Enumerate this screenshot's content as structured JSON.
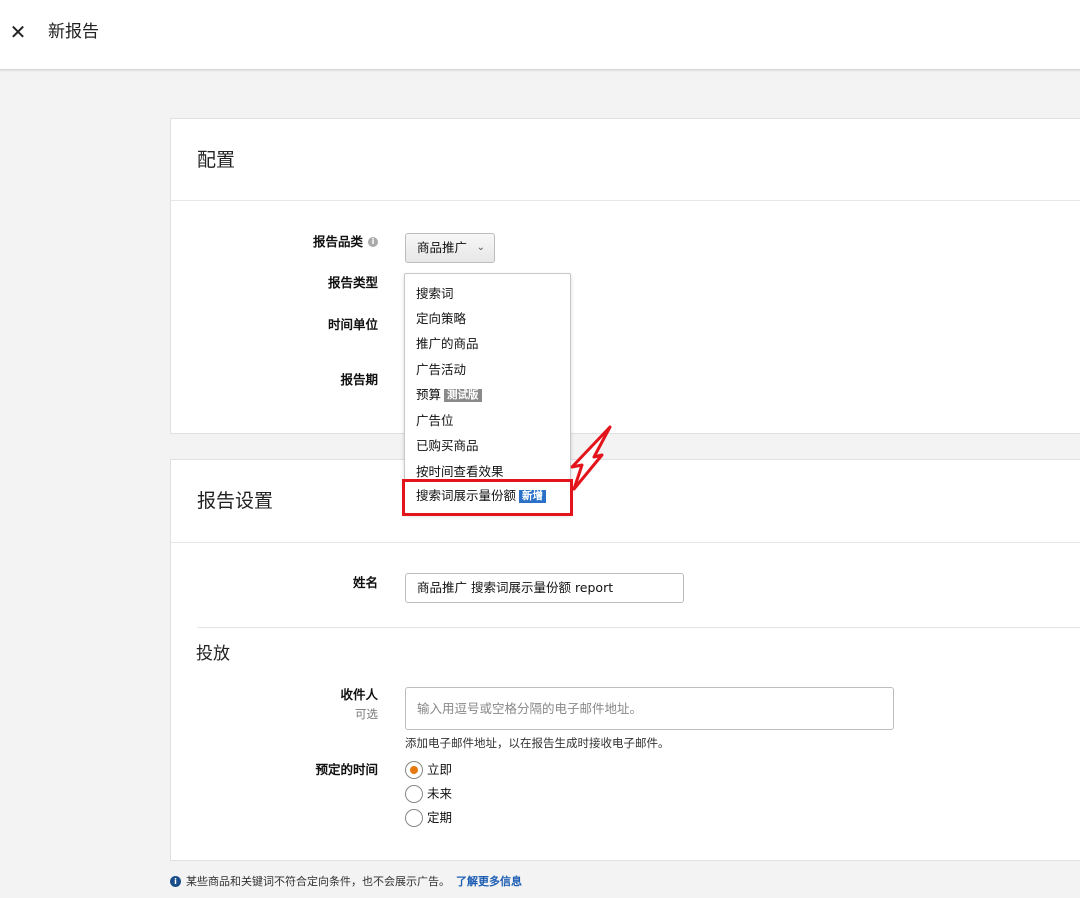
{
  "header": {
    "title": "新报告",
    "close_icon": "close-icon"
  },
  "config": {
    "title": "配置",
    "report_category_label": "报告品类",
    "report_category_value": "商品推广",
    "report_type_label": "报告类型",
    "time_unit_label": "时间单位",
    "report_period_label": "报告期",
    "dropdown_items": [
      {
        "label": "搜索词"
      },
      {
        "label": "定向策略"
      },
      {
        "label": "推广的商品"
      },
      {
        "label": "广告活动"
      },
      {
        "label": "预算",
        "tag": "测试版"
      },
      {
        "label": "广告位"
      },
      {
        "label": "已购买商品"
      },
      {
        "label": "按时间查看效果"
      },
      {
        "label": "搜索词展示量份额",
        "tag": "新增"
      }
    ],
    "highlight_color": "#e3141c"
  },
  "settings": {
    "title": "报告设置",
    "name_label": "姓名",
    "name_value": "商品推广 搜索词展示量份额 report",
    "delivery_title": "投放",
    "recipient_label": "收件人",
    "recipient_optional": "可选",
    "recipient_placeholder": "输入用逗号或空格分隔的电子邮件地址。",
    "recipient_help": "添加电子邮件地址，以在报告生成时接收电子邮件。",
    "schedule_label": "预定的时间",
    "schedule_options": [
      {
        "label": "立即",
        "checked": true
      },
      {
        "label": "未来",
        "checked": false
      },
      {
        "label": "定期",
        "checked": false
      }
    ]
  },
  "footer": {
    "note": "某些商品和关键词不符合定向条件，也不会展示广告。",
    "link": "了解更多信息"
  },
  "colors": {
    "accent_orange": "#e47911",
    "link_blue": "#1e5fb4",
    "tag_blue": "#2a70c8"
  }
}
